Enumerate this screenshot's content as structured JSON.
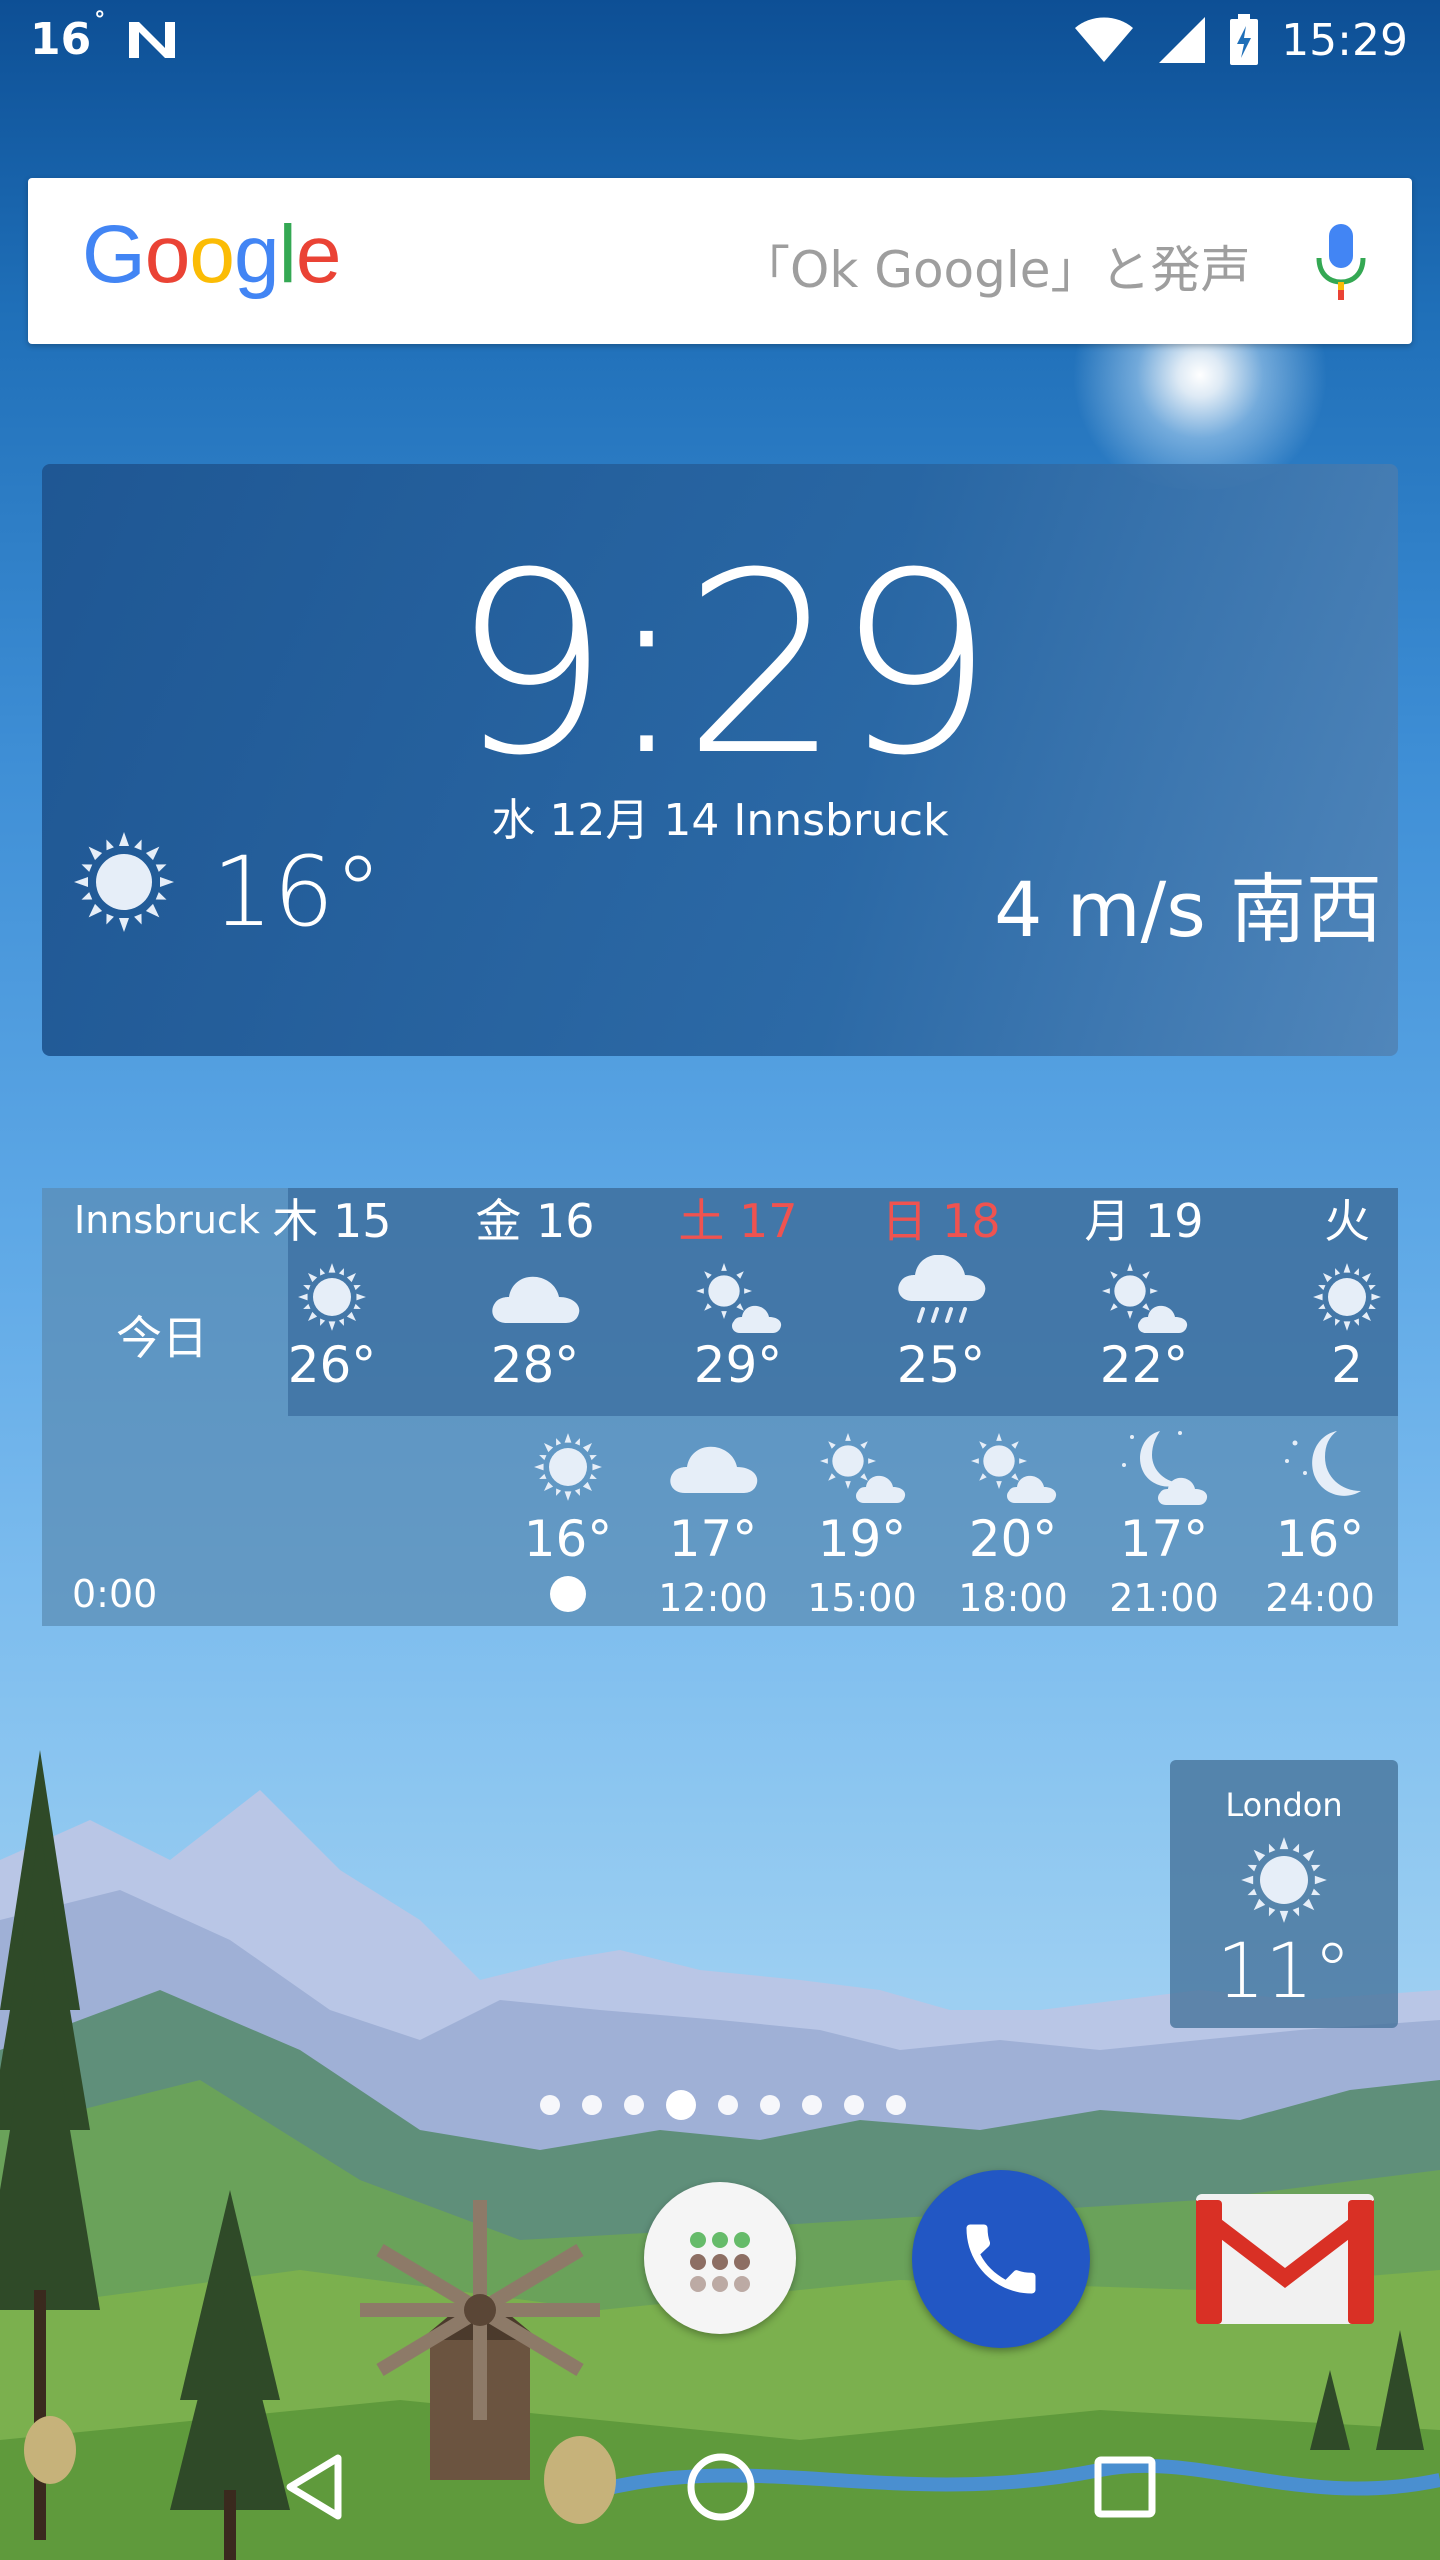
{
  "status_bar": {
    "temperature": "16",
    "degree": "°",
    "time": "15:29",
    "icons": [
      "n-notification-icon",
      "wifi-icon",
      "signal-icon",
      "battery-charging-icon"
    ]
  },
  "search": {
    "logo": "Google",
    "hint": "「Ok Google」と発声",
    "mic_icon": "mic-icon"
  },
  "clock_widget": {
    "time": "9:29",
    "date_city": "水 12月 14  Innsbruck",
    "temperature": "16°",
    "wind": "4 m/s 南西",
    "icon": "sun-icon"
  },
  "forecast": {
    "city": "Innsbruck",
    "today_label": "今日",
    "midnight_label": "0:00",
    "days": [
      {
        "label": "木 15",
        "temp": "26°",
        "icon": "sun",
        "weekend": false
      },
      {
        "label": "金 16",
        "temp": "28°",
        "icon": "cloud",
        "weekend": false
      },
      {
        "label": "土 17",
        "temp": "29°",
        "icon": "sun-cloud",
        "weekend": true
      },
      {
        "label": "日 18",
        "temp": "25°",
        "icon": "rain",
        "weekend": true
      },
      {
        "label": "月 19",
        "temp": "22°",
        "icon": "sun-cloud",
        "weekend": false
      },
      {
        "label": "火",
        "temp": "2",
        "icon": "sun",
        "weekend": false
      }
    ],
    "hours": [
      {
        "label": "",
        "temp": "16°",
        "icon": "sun",
        "now": true
      },
      {
        "label": "12:00",
        "temp": "17°",
        "icon": "cloud",
        "now": false
      },
      {
        "label": "15:00",
        "temp": "19°",
        "icon": "sun-cloud",
        "now": false
      },
      {
        "label": "18:00",
        "temp": "20°",
        "icon": "sun-cloud",
        "now": false
      },
      {
        "label": "21:00",
        "temp": "17°",
        "icon": "moon-cloud",
        "now": false
      },
      {
        "label": "24:00",
        "temp": "16°",
        "icon": "moon",
        "now": false
      }
    ]
  },
  "london_widget": {
    "city": "London",
    "temperature": "11°",
    "icon": "sun-icon"
  },
  "page_indicator": {
    "count": 9,
    "active_index": 3
  },
  "dock": [
    "app-drawer-icon",
    "phone-icon",
    "gmail-icon"
  ],
  "nav": [
    "back-icon",
    "home-icon",
    "recents-icon"
  ],
  "colors": {
    "weekend": "#ef5350",
    "phone": "#2257c4",
    "accent_blue": "#4285F4"
  }
}
